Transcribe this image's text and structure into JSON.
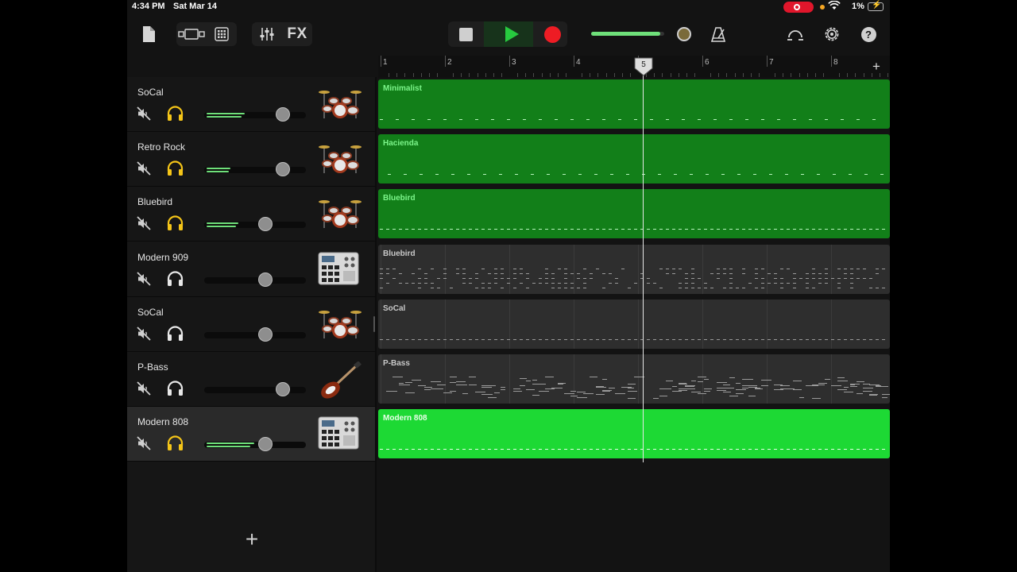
{
  "status_bar": {
    "time": "4:34 PM",
    "date": "Sat Mar 14",
    "battery": "1%"
  },
  "toolbar": {
    "fx_label": "FX",
    "icons": [
      "document-icon",
      "view-toggle-icon",
      "grid-icon",
      "mixer-icon",
      "stop-icon",
      "play-icon",
      "record-icon",
      "master-volume-knob",
      "metronome-icon",
      "loop-icon",
      "settings-icon",
      "help-icon"
    ],
    "help_label": "?",
    "master_volume": 0.95,
    "play_color": "#27c93f",
    "record_color": "#ee1c24"
  },
  "ruler": {
    "bars": [
      "1",
      "2",
      "3",
      "4",
      "5",
      "6",
      "7",
      "8"
    ],
    "add_label": "+",
    "playhead_bar": "5"
  },
  "tracks": [
    {
      "name": "SoCal",
      "instrument": "drum-kit-icon",
      "solo_active": true,
      "volume": 0.77,
      "meter": 0.48
    },
    {
      "name": "Retro Rock",
      "instrument": "drum-kit-icon",
      "solo_active": true,
      "volume": 0.77,
      "meter": 0.3
    },
    {
      "name": "Bluebird",
      "instrument": "drum-kit-icon",
      "solo_active": true,
      "volume": 0.6,
      "meter": 0.4
    },
    {
      "name": "Modern 909",
      "instrument": "drum-machine-icon",
      "solo_active": false,
      "volume": 0.6,
      "meter": 0
    },
    {
      "name": "SoCal",
      "instrument": "drum-kit-icon",
      "solo_active": false,
      "volume": 0.6,
      "meter": 0
    },
    {
      "name": "P-Bass",
      "instrument": "bass-guitar-icon",
      "solo_active": false,
      "volume": 0.77,
      "meter": 0
    },
    {
      "name": "Modern 808",
      "instrument": "drum-machine-icon",
      "solo_active": true,
      "volume": 0.6,
      "meter": 0.6,
      "selected": true
    }
  ],
  "regions": [
    {
      "name": "Minimalist",
      "style": "green"
    },
    {
      "name": "Hacienda",
      "style": "green"
    },
    {
      "name": "Bluebird",
      "style": "green"
    },
    {
      "name": "Bluebird",
      "style": "gray"
    },
    {
      "name": "SoCal",
      "style": "gray"
    },
    {
      "name": "P-Bass",
      "style": "gray"
    },
    {
      "name": "Modern 808",
      "style": "bright"
    }
  ],
  "add_track_label": "+"
}
